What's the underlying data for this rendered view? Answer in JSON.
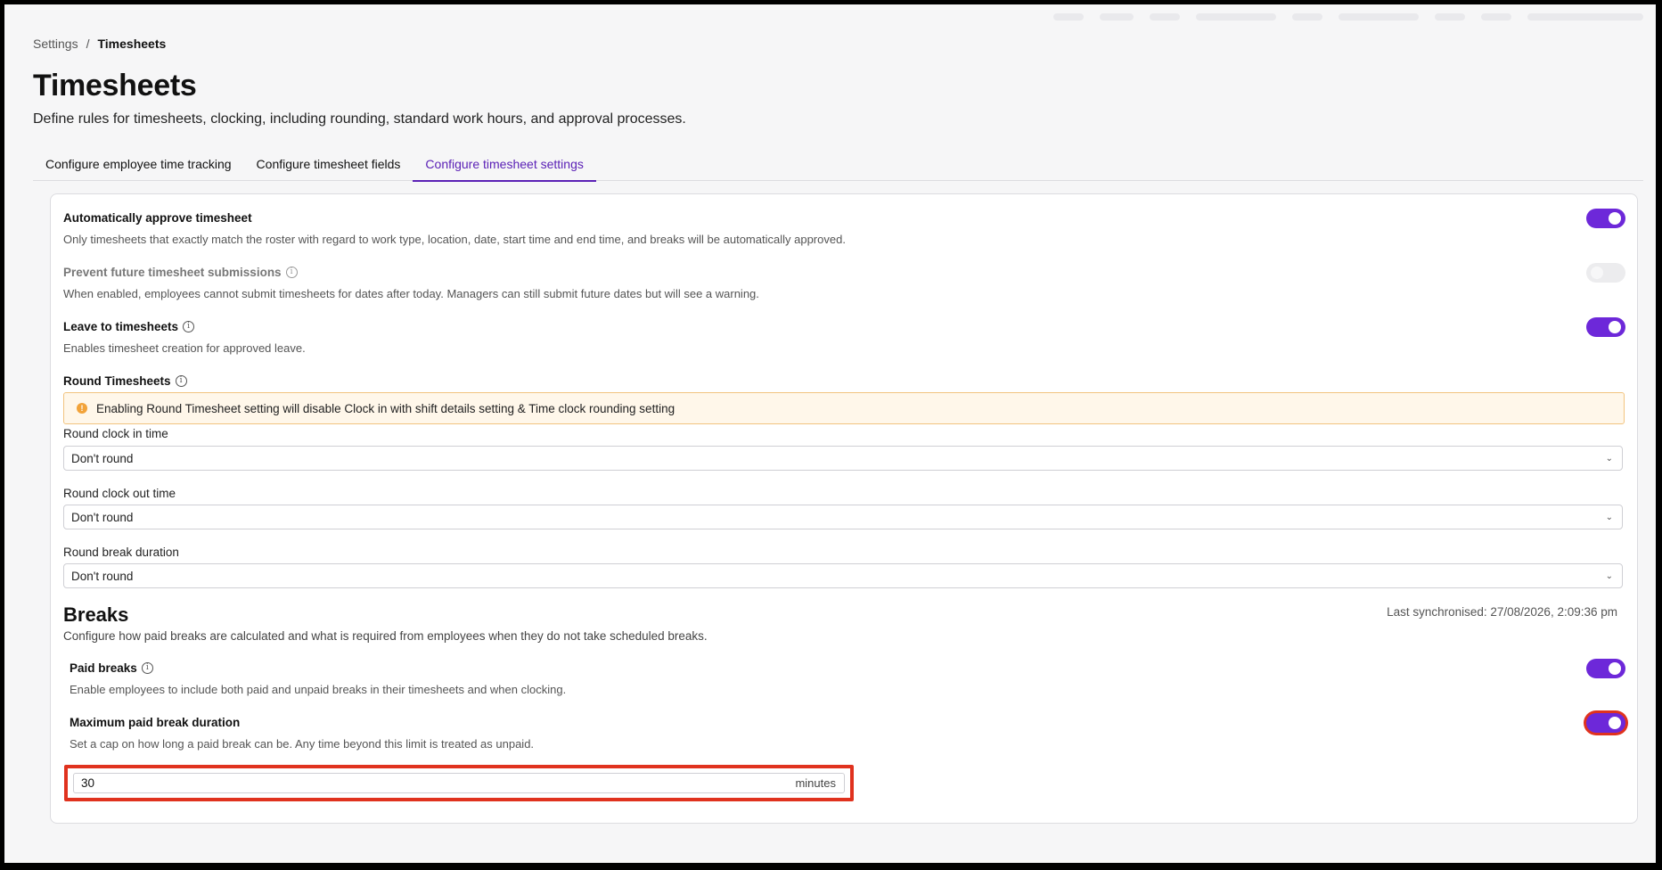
{
  "breadcrumb": {
    "parent": "Settings",
    "separator": "/",
    "current": "Timesheets"
  },
  "page": {
    "title": "Timesheets",
    "description": "Define rules for timesheets, clocking, including rounding, standard work hours, and approval processes."
  },
  "tabs": [
    {
      "label": "Configure employee time tracking",
      "active": false
    },
    {
      "label": "Configure timesheet fields",
      "active": false
    },
    {
      "label": "Configure timesheet settings",
      "active": true
    }
  ],
  "settings": {
    "auto_approve": {
      "title": "Automatically approve timesheet",
      "description": "Only timesheets that exactly match the roster with regard to work type, location, date, start time and end time, and breaks will be automatically approved.",
      "enabled": true
    },
    "prevent_future": {
      "title": "Prevent future timesheet submissions",
      "description": "When enabled, employees cannot submit timesheets for dates after today. Managers can still submit future dates but will see a warning.",
      "enabled": false,
      "disabled": true
    },
    "leave_to_timesheets": {
      "title": "Leave to timesheets",
      "description": "Enables timesheet creation for approved leave.",
      "enabled": true
    }
  },
  "round": {
    "title": "Round Timesheets",
    "warning": "Enabling Round Timesheet setting will disable Clock in with shift details setting & Time clock rounding setting",
    "clock_in": {
      "label": "Round clock in time",
      "value": "Don't round"
    },
    "clock_out": {
      "label": "Round clock out time",
      "value": "Don't round"
    },
    "break_duration": {
      "label": "Round break duration",
      "value": "Don't round"
    }
  },
  "breaks": {
    "title": "Breaks",
    "last_sync": "Last synchronised: 27/08/2026, 2:09:36 pm",
    "description": "Configure how paid breaks are calculated and what is required from employees when they do not take scheduled breaks.",
    "paid_breaks": {
      "title": "Paid breaks",
      "description": "Enable employees to include both paid and unpaid breaks in their timesheets and when clocking.",
      "enabled": true
    },
    "max_paid": {
      "title": "Maximum paid break duration",
      "description": "Set a cap on how long a paid break can be. Any time beyond this limit is treated as unpaid.",
      "enabled": true,
      "value": "30",
      "unit": "minutes"
    }
  },
  "icons": {
    "info": "info-icon",
    "warning": "warning-icon",
    "chevron": "chevron-down-icon"
  },
  "colors": {
    "accent": "#6d28d9",
    "highlight": "#e0321e",
    "warning_bg": "#fff7ea",
    "warning_border": "#f2c47f"
  }
}
